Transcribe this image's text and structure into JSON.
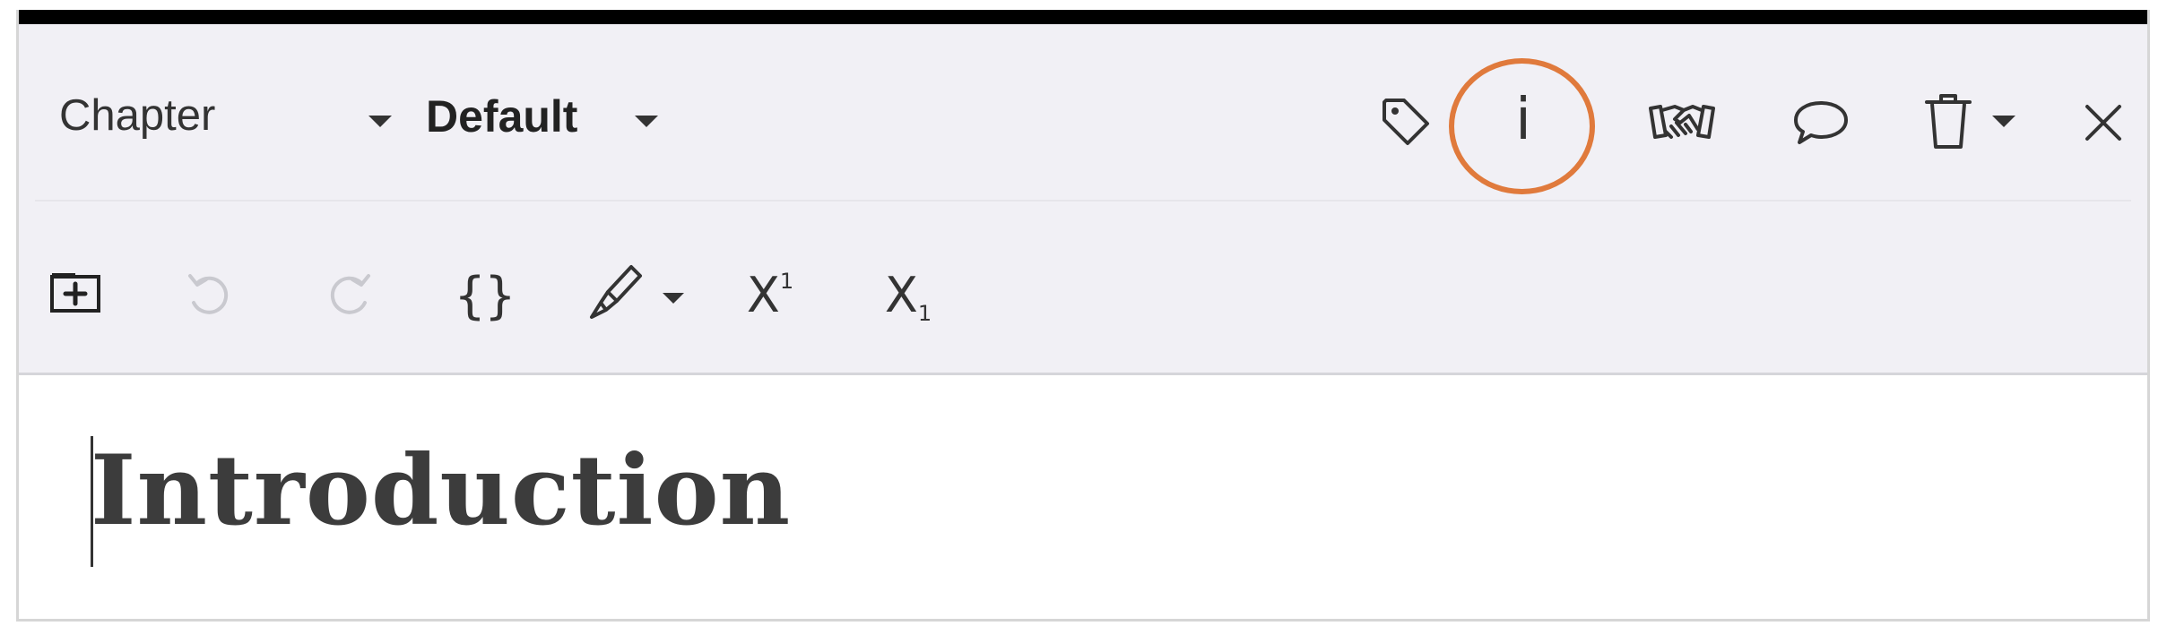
{
  "toolbar": {
    "element_type": "Chapter",
    "style_label": "Default",
    "undo_enabled": false,
    "redo_enabled": false,
    "icons": {
      "tag": "tag-icon",
      "info": "info-icon",
      "info_glyph": "i",
      "handshake": "handshake-icon",
      "comment": "comment-icon",
      "trash": "trash-icon",
      "close": "close-icon",
      "insert": "insert-section-icon",
      "undo": "undo-icon",
      "redo": "redo-icon",
      "code": "curly-braces-icon",
      "code_glyph": "{}",
      "highlighter": "highlighter-pen-icon",
      "superscript": "superscript-icon",
      "superscript_base": "X",
      "superscript_mark": "1",
      "subscript": "subscript-icon",
      "subscript_base": "X",
      "subscript_mark": "1"
    },
    "highlight_color": "#e07a3c",
    "disabled_color": "#c9c9cf"
  },
  "editor": {
    "heading": "Introduction"
  }
}
